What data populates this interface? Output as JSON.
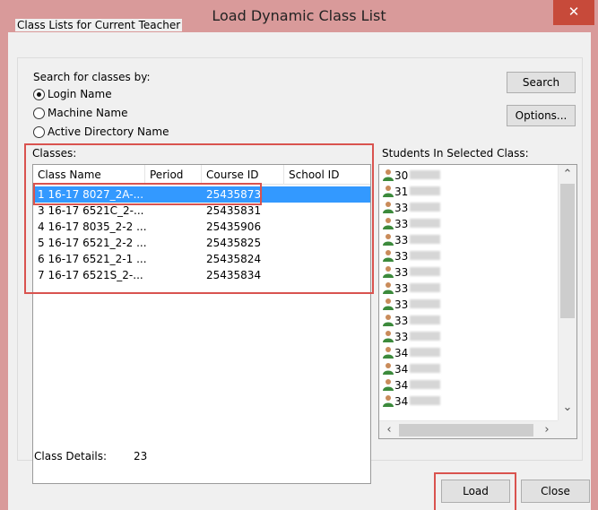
{
  "window": {
    "title": "Load Dynamic Class List",
    "close_symbol": "✕"
  },
  "group": {
    "caption": "Class Lists for Current Teacher"
  },
  "search": {
    "label": "Search for classes by:",
    "options": [
      {
        "label": "Login Name",
        "checked": true
      },
      {
        "label": "Machine Name",
        "checked": false
      },
      {
        "label": "Active Directory Name",
        "checked": false
      }
    ],
    "search_button": "Search",
    "options_button": "Options..."
  },
  "classes": {
    "label": "Classes:",
    "columns": [
      "Class Name",
      "Period",
      "Course ID",
      "School ID"
    ],
    "rows": [
      {
        "name": "1 16-17 8027_2A-...",
        "period": "",
        "course_id": "25435873",
        "school_id": "",
        "selected": true
      },
      {
        "name": "3 16-17 6521C_2-...",
        "period": "",
        "course_id": "25435831",
        "school_id": ""
      },
      {
        "name": "4 16-17 8035_2-2 ...",
        "period": "",
        "course_id": "25435906",
        "school_id": ""
      },
      {
        "name": "5 16-17 6521_2-2 ...",
        "period": "",
        "course_id": "25435825",
        "school_id": ""
      },
      {
        "name": "6 16-17 6521_2-1 ...",
        "period": "",
        "course_id": "25435824",
        "school_id": ""
      },
      {
        "name": "7 16-17 6521S_2-...",
        "period": "",
        "course_id": "25435834",
        "school_id": ""
      }
    ]
  },
  "students": {
    "label": "Students In Selected Class:",
    "items": [
      "30",
      "31",
      "33",
      "33",
      "33",
      "33",
      "33",
      "33",
      "33",
      "33",
      "33",
      "34",
      "34",
      "34",
      "34"
    ]
  },
  "details": {
    "label": "Class Details:",
    "value": "23"
  },
  "buttons": {
    "load": "Load",
    "close": "Close"
  },
  "colors": {
    "selection": "#3399ff",
    "highlight_box": "#d9534f",
    "title_bar": "#d99a9a"
  }
}
